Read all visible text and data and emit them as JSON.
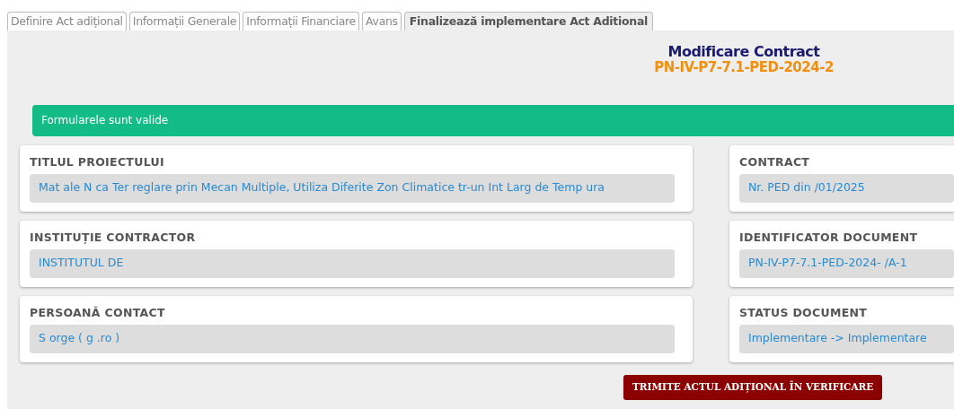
{
  "tabs": [
    {
      "label": "Definire Act adițional",
      "selected": false
    },
    {
      "label": "Informații Generale",
      "selected": false
    },
    {
      "label": "Informații Financiare",
      "selected": false
    },
    {
      "label": "Avans",
      "selected": false
    },
    {
      "label": "Finalizează implementare Act Aditional",
      "selected": true
    }
  ],
  "header": {
    "title": "Modificare Contract",
    "code": "PN-IV-P7-7.1-PED-2024-2"
  },
  "alert": "Formularele sunt valide",
  "left_cards": [
    {
      "label": "TITLUL PROIECTULUI",
      "value": "Mat ale N ca Ter reglare prin Mecan Multiple, Utiliza Diferite Zon Climatice tr-un Int Larg de Temp ura"
    },
    {
      "label": "INSTITUȚIE CONTRACTOR",
      "value": "INSTITUTUL DE"
    },
    {
      "label": "PERSOANĂ CONTACT",
      "value": "S orge ( g .ro )"
    }
  ],
  "right_cards": [
    {
      "label": "CONTRACT",
      "value": "Nr. PED din /01/2025"
    },
    {
      "label": "IDENTIFICATOR DOCUMENT",
      "value": "PN-IV-P7-7.1-PED-2024- /A-1"
    },
    {
      "label": "STATUS DOCUMENT",
      "value": "Implementare -> Implementare"
    }
  ],
  "submit_button": "TRIMITE ACTUL ADIȚIONAL ÎN VERIFICARE"
}
